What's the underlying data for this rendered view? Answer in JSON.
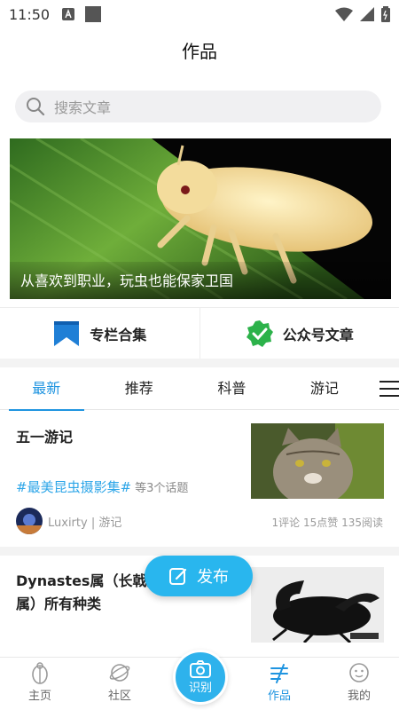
{
  "status_bar": {
    "time": "11:50"
  },
  "header": {
    "title": "作品"
  },
  "search": {
    "placeholder": "搜索文章"
  },
  "banner": {
    "caption": "从喜欢到职业，玩虫也能保家卫国"
  },
  "quick_links": [
    {
      "label": "专栏合集",
      "icon": "bookmark-icon"
    },
    {
      "label": "公众号文章",
      "icon": "verified-badge-icon"
    }
  ],
  "tabs": [
    "最新",
    "推荐",
    "科普",
    "游记"
  ],
  "active_tab": "最新",
  "articles": [
    {
      "title": "五一游记",
      "tag": "#最美昆虫摄影集#",
      "tag_more": "等3个话题",
      "author": "Luxirty | 游记",
      "stats": "1评论  15点赞  135阅读"
    },
    {
      "title": "Dynastes属（长戟大兜）与金龟属）所有种类"
    }
  ],
  "fab": {
    "label": "发布"
  },
  "bottom_nav": {
    "items": [
      "主页",
      "社区",
      "识别",
      "作品",
      "我的"
    ],
    "active": "作品"
  },
  "colors": {
    "accent": "#1f94e0",
    "fab": "#29b6ee",
    "tag": "#2ea6e8"
  }
}
